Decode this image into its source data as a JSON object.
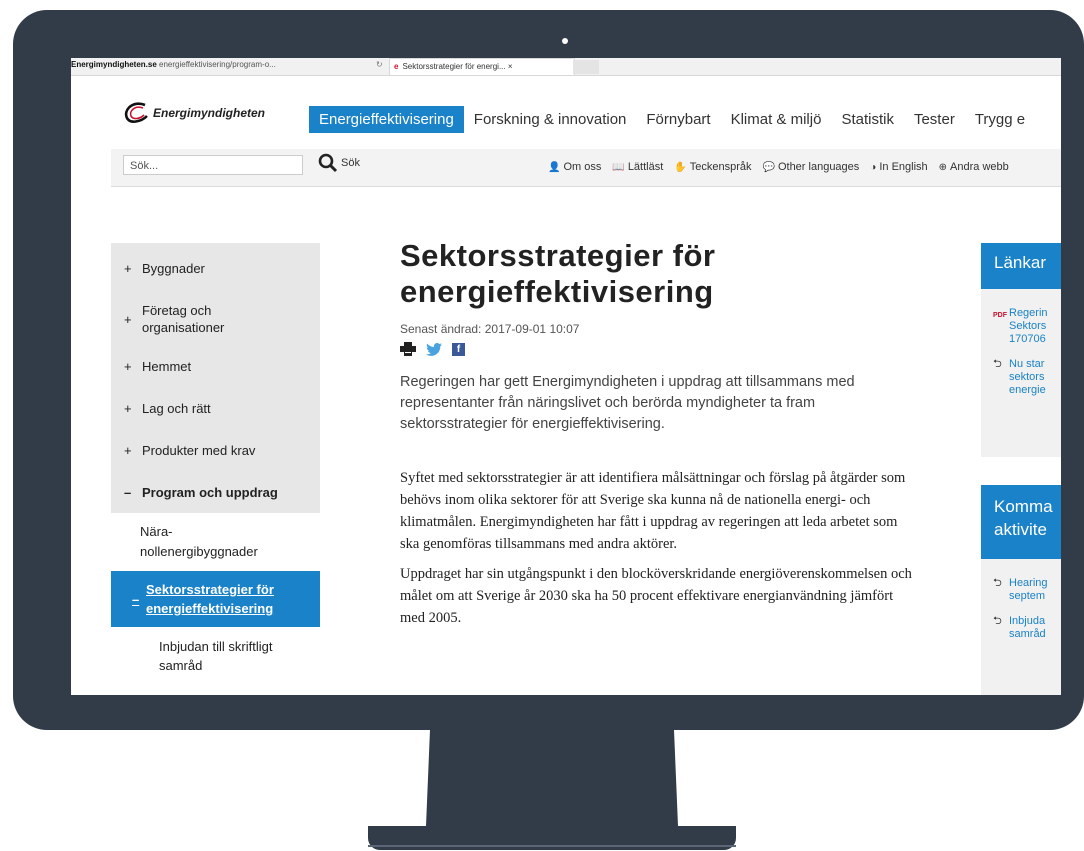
{
  "browser": {
    "address_bold": "Energimyndigheten.se",
    "address_rest": " energieffektivisering/program-o...",
    "refresh_glyph": "↻",
    "tab_favicon": "e",
    "tab_title": "Sektorsstrategier för energi...",
    "tab_close": "×"
  },
  "header": {
    "logo_text": "Energimyndigheten",
    "nav": [
      "Energieffektivisering",
      "Forskning & innovation",
      "Förnybart",
      "Klimat & miljö",
      "Statistik",
      "Tester",
      "Trygg e"
    ]
  },
  "search": {
    "placeholder": "Sök...",
    "button_label": "Sök",
    "button_icon": "search-icon"
  },
  "utilities": [
    {
      "icon": "person-icon",
      "glyph": "👤",
      "label": "Om oss"
    },
    {
      "icon": "easy-read-icon",
      "glyph": "📖",
      "label": "Lättläst"
    },
    {
      "icon": "sign-language-icon",
      "glyph": "✋",
      "label": "Teckenspråk"
    },
    {
      "icon": "speech-bubble-icon",
      "glyph": "💬",
      "label": "Other languages"
    },
    {
      "icon": "globe-icon",
      "glyph": "◑",
      "label": "In English"
    },
    {
      "icon": "web-icon",
      "glyph": "⊕",
      "label": "Andra webb"
    }
  ],
  "sidebar": {
    "items": [
      {
        "prefix": "+",
        "label": "Byggnader"
      },
      {
        "prefix": "+",
        "label": "Företag och organisationer"
      },
      {
        "prefix": "+",
        "label": "Hemmet"
      },
      {
        "prefix": "+",
        "label": "Lag och rätt"
      },
      {
        "prefix": "+",
        "label": "Produkter med krav"
      },
      {
        "prefix": "–",
        "label": "Program och uppdrag"
      }
    ],
    "sub_item": "Nära-nollenergibyggnader",
    "current": {
      "prefix": "–",
      "label": "Sektorsstrategier för energieffektivisering"
    },
    "sub_sub_item": "Inbjudan till skriftligt samråd"
  },
  "article": {
    "title": "Sektorsstrategier för energieffektivisering",
    "updated": "Senast ändrad: 2017-09-01 10:07",
    "lead": "Regeringen har gett Energimyndigheten i uppdrag att tillsammans med representanter från näringslivet och berörda myndigheter ta fram sektorsstrategier för energieffektivisering.",
    "p1": "Syftet med sektorsstrategier är att identifiera målsättningar och förslag på åtgärder som behövs inom olika sektorer för att Sverige ska kunna nå de nationella energi- och klimatmålen. Energimyndigheten har fått i uppdrag av regeringen att leda arbetet som ska genomföras tillsammans med andra aktörer.",
    "p2": "Uppdraget har sin utgångspunkt i den blocköverskridande energiöverenskommelsen och målet om att Sverige år 2030 ska ha 50 procent effektivare energianvändning jämfört med 2005."
  },
  "right": {
    "links_title": "Länkar",
    "links": [
      {
        "icon": "pdf-icon",
        "glyph": "PDF",
        "text": "Regerin\nSektors\n170706"
      },
      {
        "icon": "arrow-link-icon",
        "glyph": "⮌",
        "text": "Nu star\nsektors\nenergie"
      }
    ],
    "events_title": "Komma\naktivite",
    "events": [
      {
        "icon": "arrow-link-icon",
        "glyph": "⮌",
        "text": "Hearing\nseptem"
      },
      {
        "icon": "arrow-link-icon",
        "glyph": "⮌",
        "text": "Inbjuda\nsamråd"
      }
    ]
  }
}
